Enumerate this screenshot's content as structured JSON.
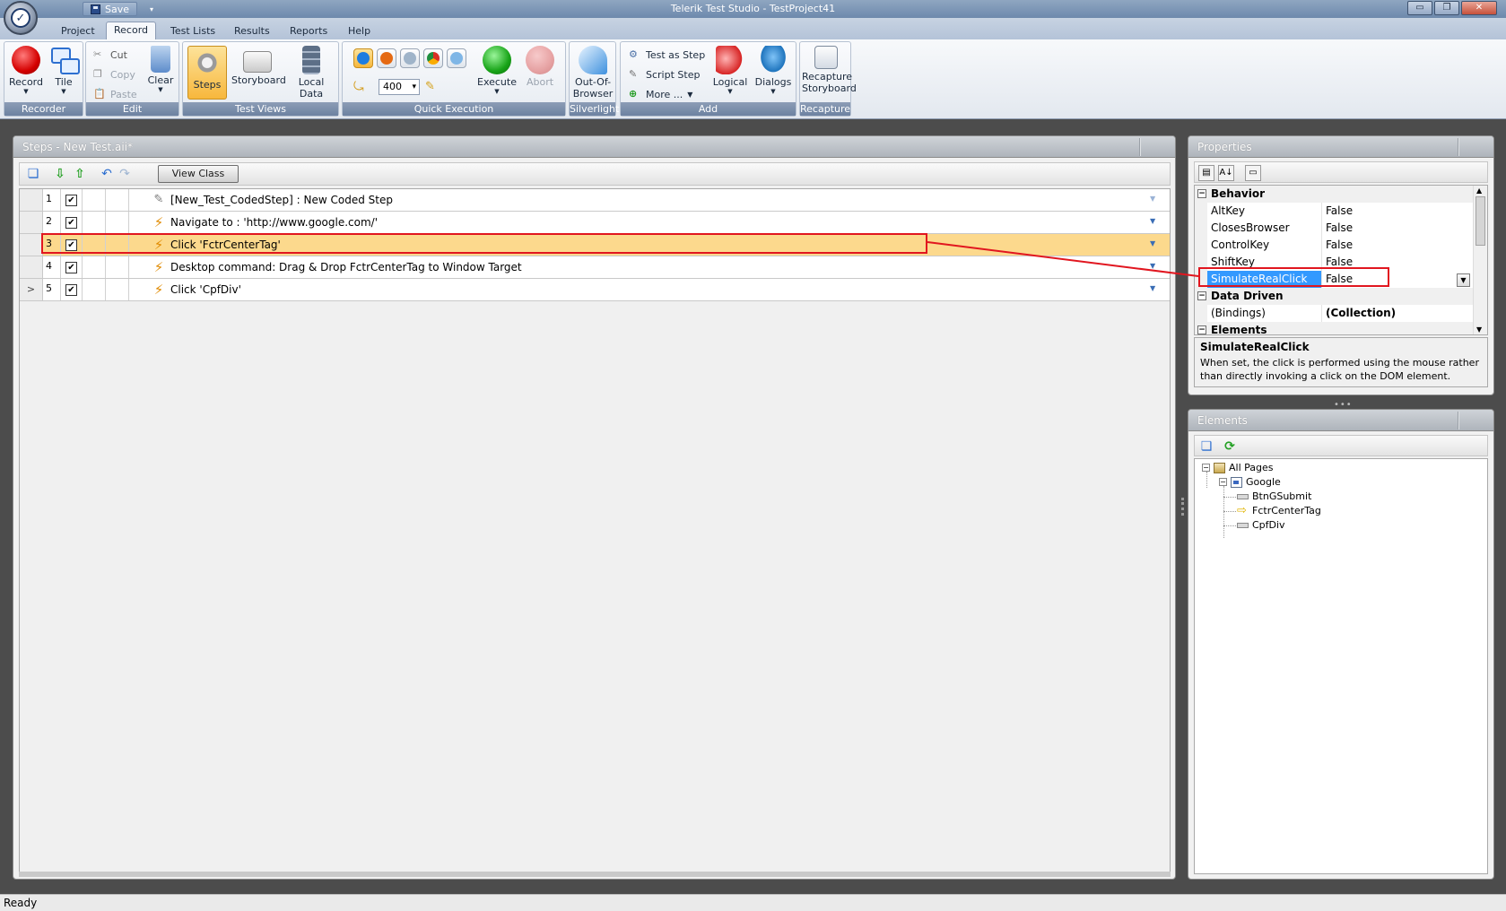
{
  "window": {
    "title": "Telerik Test Studio - TestProject41",
    "min": "▭",
    "max": "❐",
    "close": "✕"
  },
  "qat": {
    "save_label": "Save",
    "dropdown": "▾"
  },
  "menu_tabs": [
    "Project",
    "Record",
    "Test Lists",
    "Results",
    "Reports",
    "Help"
  ],
  "active_tab": "Record",
  "ribbon": {
    "recorder": {
      "label": "Recorder",
      "record": "Record",
      "tile": "Tile"
    },
    "edit": {
      "label": "Edit",
      "cut": "Cut",
      "copy": "Copy",
      "paste": "Paste",
      "clear": "Clear"
    },
    "test_views": {
      "label": "Test Views",
      "steps": "Steps",
      "storyboard": "Storyboard",
      "local_data": "Local Data"
    },
    "quick_execution": {
      "label": "Quick Execution",
      "delay_value": "400",
      "execute": "Execute",
      "abort": "Abort"
    },
    "silverlight": {
      "label": "Silverlight",
      "oob_line1": "Out-Of-",
      "oob_line2": "Browser"
    },
    "add": {
      "label": "Add",
      "test_as_step": "Test as Step",
      "script_step": "Script Step",
      "more": "More ...",
      "logical": "Logical",
      "dialogs": "Dialogs"
    },
    "recapture": {
      "label": "Recapture",
      "line1": "Recapture",
      "line2": "Storyboard"
    }
  },
  "steps_panel": {
    "title": "Steps - New Test.aii*",
    "view_class": "View Class",
    "steps": [
      {
        "num": "1",
        "checked": "✔",
        "text": "[New_Test_CodedStep] : New Coded Step",
        "gutter": ""
      },
      {
        "num": "2",
        "checked": "✔",
        "text": "Navigate to : 'http://www.google.com/'",
        "gutter": ""
      },
      {
        "num": "3",
        "checked": "✔",
        "text": "Click 'FctrCenterTag'",
        "gutter": ""
      },
      {
        "num": "4",
        "checked": "✔",
        "text": "Desktop command: Drag & Drop FctrCenterTag to Window Target",
        "gutter": ""
      },
      {
        "num": "5",
        "checked": "✔",
        "text": "Click 'CpfDiv'",
        "gutter": ">"
      }
    ],
    "selected_step": "3"
  },
  "properties_panel": {
    "title": "Properties",
    "categories": [
      {
        "name": "Behavior",
        "expander": "−"
      },
      {
        "name": "Data Driven",
        "expander": "−"
      },
      {
        "name": "Elements",
        "expander": "−"
      }
    ],
    "behavior": [
      {
        "name": "AltKey",
        "value": "False"
      },
      {
        "name": "ClosesBrowser",
        "value": "False"
      },
      {
        "name": "ControlKey",
        "value": "False"
      },
      {
        "name": "ShiftKey",
        "value": "False"
      },
      {
        "name": "SimulateRealClick",
        "value": "False"
      }
    ],
    "data_driven": [
      {
        "name": "(Bindings)",
        "value": "(Collection)"
      }
    ],
    "selected_property": "SimulateRealClick",
    "description_title": "SimulateRealClick",
    "description_text": "When set, the click is performed using the mouse rather than directly invoking a click on the DOM element."
  },
  "elements_panel": {
    "title": "Elements",
    "tree": {
      "root": "All Pages",
      "page": "Google",
      "elements": [
        "BtnGSubmit",
        "FctrCenterTag",
        "CpfDiv"
      ]
    }
  },
  "status": "Ready",
  "colors": {
    "highlight_red": "#e1161f",
    "selected_row": "#fcd98d",
    "selected_prop": "#3399ff"
  }
}
